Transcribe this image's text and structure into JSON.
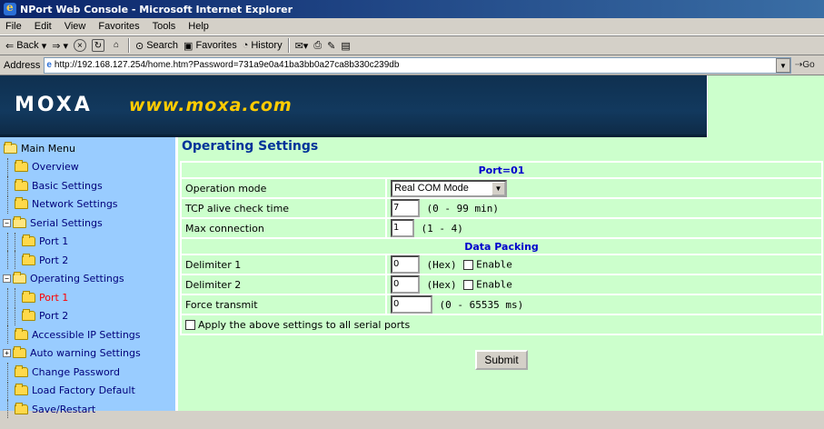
{
  "window": {
    "title": "NPort Web Console - Microsoft Internet Explorer"
  },
  "menubar": [
    "File",
    "Edit",
    "View",
    "Favorites",
    "Tools",
    "Help"
  ],
  "toolbar": {
    "back": "Back",
    "search": "Search",
    "favorites": "Favorites",
    "history": "History"
  },
  "address": {
    "label": "Address",
    "url": "http://192.168.127.254/home.htm?Password=731a9e0a41ba3bb0a27ca8b330c239db",
    "go": "Go"
  },
  "banner": {
    "logo": "MOXA",
    "url": "www.moxa.com"
  },
  "sidebar": {
    "items": [
      {
        "label": "Main Menu"
      },
      {
        "label": "Overview"
      },
      {
        "label": "Basic Settings"
      },
      {
        "label": "Network Settings"
      },
      {
        "label": "Serial Settings"
      },
      {
        "label": "Port 1"
      },
      {
        "label": "Port 2"
      },
      {
        "label": "Operating Settings"
      },
      {
        "label": "Port 1"
      },
      {
        "label": "Port 2"
      },
      {
        "label": "Accessible IP Settings"
      },
      {
        "label": "Auto warning Settings"
      },
      {
        "label": "Change Password"
      },
      {
        "label": "Load Factory Default"
      },
      {
        "label": "Save/Restart"
      }
    ]
  },
  "main": {
    "title": "Operating Settings",
    "port_header": "Port=01",
    "operation_mode": {
      "label": "Operation mode",
      "value": "Real COM Mode"
    },
    "tcp_alive": {
      "label": "TCP alive check time",
      "value": "7",
      "hint": "(0 - 99 min)"
    },
    "max_connection": {
      "label": "Max connection",
      "value": "1",
      "hint": "(1 - 4)"
    },
    "data_packing": "Data Packing",
    "delimiter1": {
      "label": "Delimiter 1",
      "value": "0",
      "hint": "(Hex)",
      "enable": "Enable"
    },
    "delimiter2": {
      "label": "Delimiter 2",
      "value": "0",
      "hint": "(Hex)",
      "enable": "Enable"
    },
    "force_transmit": {
      "label": "Force transmit",
      "value": "0",
      "hint": "(0 - 65535 ms)"
    },
    "apply_all": "Apply the above settings to all serial ports",
    "submit": "Submit"
  }
}
